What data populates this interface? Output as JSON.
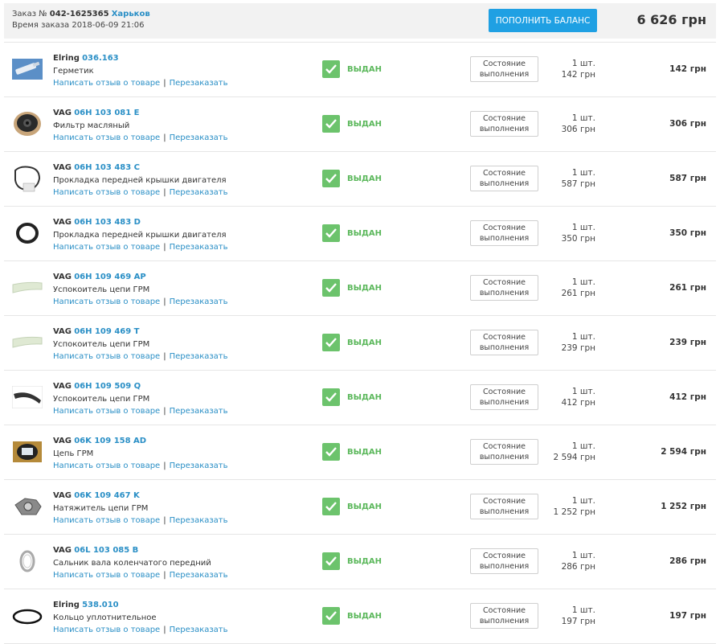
{
  "header": {
    "order_label": "Заказ №",
    "order_number": "042-1625365",
    "city": "Харьков",
    "order_time": "Время заказа 2018-06-09 21:06",
    "topup_label": "ПОПОЛНИТЬ БАЛАНС",
    "total": "6 626 грн"
  },
  "labels": {
    "review": "Написать отзыв о товаре",
    "separator": "|",
    "reorder": "Перезаказать",
    "status": "ВЫДАН",
    "state_button_line1": "Состояние",
    "state_button_line2": "выполнения"
  },
  "items": [
    {
      "brand": "Elring",
      "article": "036.163",
      "name": "Герметик",
      "qty": "1 шт.",
      "price": "142 грн",
      "total": "142 грн",
      "icon": "sealant-tube-icon"
    },
    {
      "brand": "VAG",
      "article": "06H 103 081 E",
      "name": "Фильтр масляный",
      "qty": "1 шт.",
      "price": "306 грн",
      "total": "306 грн",
      "icon": "oil-filter-icon"
    },
    {
      "brand": "VAG",
      "article": "06H 103 483 C",
      "name": "Прокладка передней крышки двигателя",
      "qty": "1 шт.",
      "price": "587 грн",
      "total": "587 грн",
      "icon": "gasket-icon"
    },
    {
      "brand": "VAG",
      "article": "06H 103 483 D",
      "name": "Прокладка передней крышки двигателя",
      "qty": "1 шт.",
      "price": "350 грн",
      "total": "350 грн",
      "icon": "seal-ring-icon"
    },
    {
      "brand": "VAG",
      "article": "06H 109 469 AP",
      "name": "Успокоитель цепи ГРМ",
      "qty": "1 шт.",
      "price": "261 грн",
      "total": "261 грн",
      "icon": "chain-guide-icon"
    },
    {
      "brand": "VAG",
      "article": "06H 109 469 T",
      "name": "Успокоитель цепи ГРМ",
      "qty": "1 шт.",
      "price": "239 грн",
      "total": "239 грн",
      "icon": "chain-guide-icon"
    },
    {
      "brand": "VAG",
      "article": "06H 109 509 Q",
      "name": "Успокоитель цепи ГРМ",
      "qty": "1 шт.",
      "price": "412 грн",
      "total": "412 грн",
      "icon": "tensioner-rail-icon"
    },
    {
      "brand": "VAG",
      "article": "06K 109 158 AD",
      "name": "Цепь ГРМ",
      "qty": "1 шт.",
      "price": "2 594 грн",
      "total": "2 594 грн",
      "icon": "timing-chain-box-icon"
    },
    {
      "brand": "VAG",
      "article": "06K 109 467 K",
      "name": "Натяжитель цепи ГРМ",
      "qty": "1 шт.",
      "price": "1 252 грн",
      "total": "1 252 грн",
      "icon": "chain-tensioner-icon"
    },
    {
      "brand": "VAG",
      "article": "06L 103 085 B",
      "name": "Сальник вала коленчатого передний",
      "qty": "1 шт.",
      "price": "286 грн",
      "total": "286 грн",
      "icon": "shaft-seal-icon"
    },
    {
      "brand": "Elring",
      "article": "538.010",
      "name": "Кольцо уплотнительное",
      "qty": "1 шт.",
      "price": "197 грн",
      "total": "197 грн",
      "icon": "o-ring-icon"
    }
  ]
}
